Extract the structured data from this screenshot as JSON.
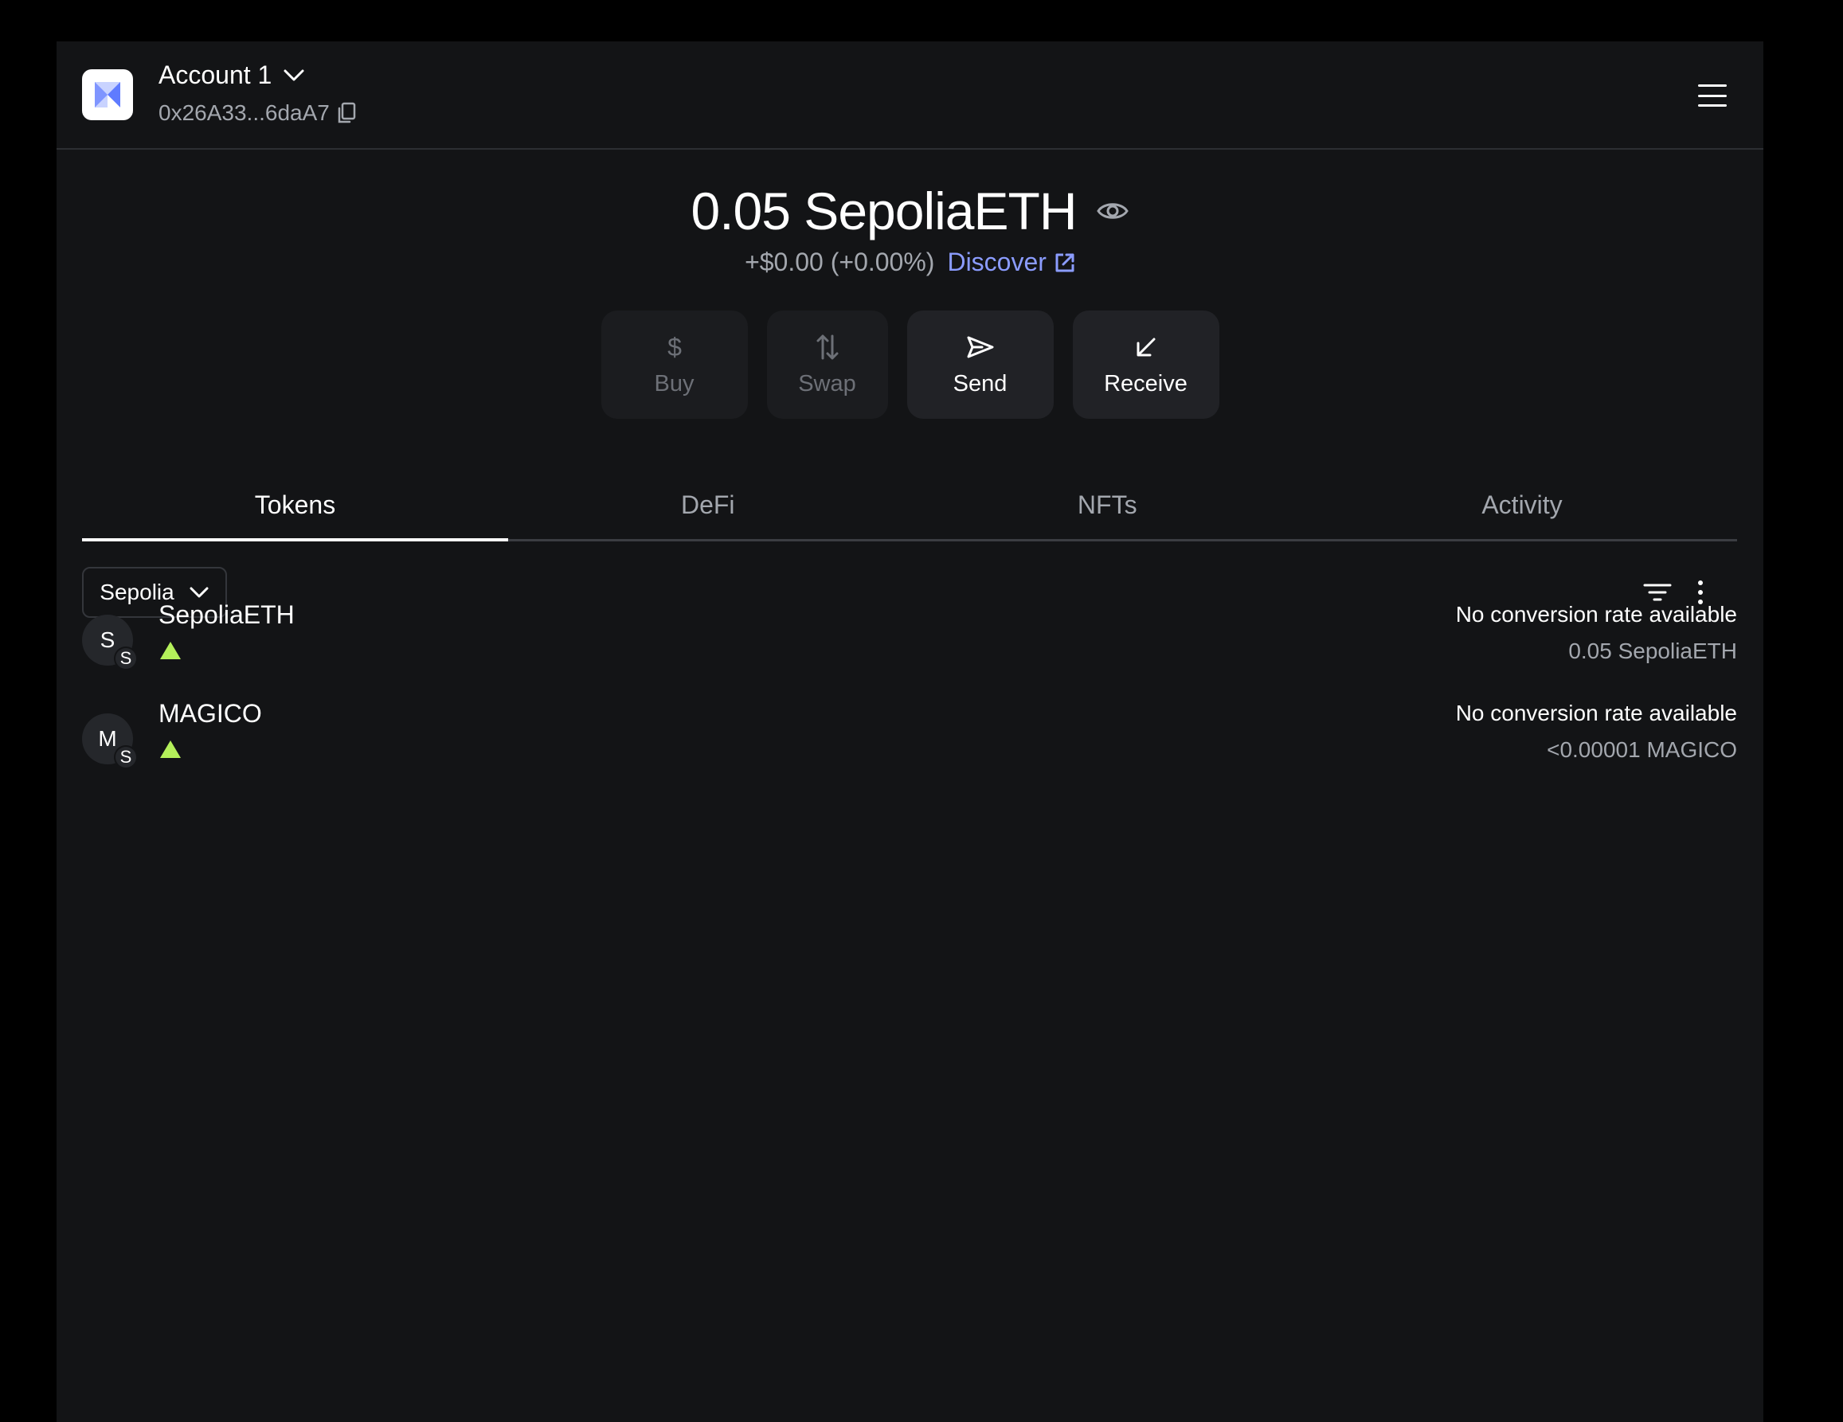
{
  "header": {
    "account_name": "Account 1",
    "account_address": "0x26A33...6daA7"
  },
  "balance": {
    "amount": "0.05 SepoliaETH",
    "change": "+$0.00 (+0.00%)",
    "discover_label": "Discover"
  },
  "actions": [
    {
      "label": "Buy",
      "icon": "dollar-icon",
      "enabled": false
    },
    {
      "label": "Swap",
      "icon": "swap-arrows-icon",
      "enabled": false
    },
    {
      "label": "Send",
      "icon": "send-icon",
      "enabled": true
    },
    {
      "label": "Receive",
      "icon": "receive-arrow-icon",
      "enabled": true
    }
  ],
  "tabs": [
    {
      "label": "Tokens",
      "active": true
    },
    {
      "label": "DeFi",
      "active": false
    },
    {
      "label": "NFTs",
      "active": false
    },
    {
      "label": "Activity",
      "active": false
    }
  ],
  "network_filter": {
    "selected": "Sepolia"
  },
  "tokens": [
    {
      "avatar_letter": "S",
      "network_badge": "S",
      "name": "SepoliaETH",
      "conversion": "No conversion rate available",
      "amount": "0.05 SepoliaETH"
    },
    {
      "avatar_letter": "M",
      "network_badge": "S",
      "name": "MAGICO",
      "conversion": "No conversion rate available",
      "amount": "<0.00001 MAGICO"
    }
  ],
  "colors": {
    "background": "#131416",
    "accent_link": "#8b9cff",
    "trend_up": "#b4f05a",
    "muted_text": "#a3a7ae"
  }
}
